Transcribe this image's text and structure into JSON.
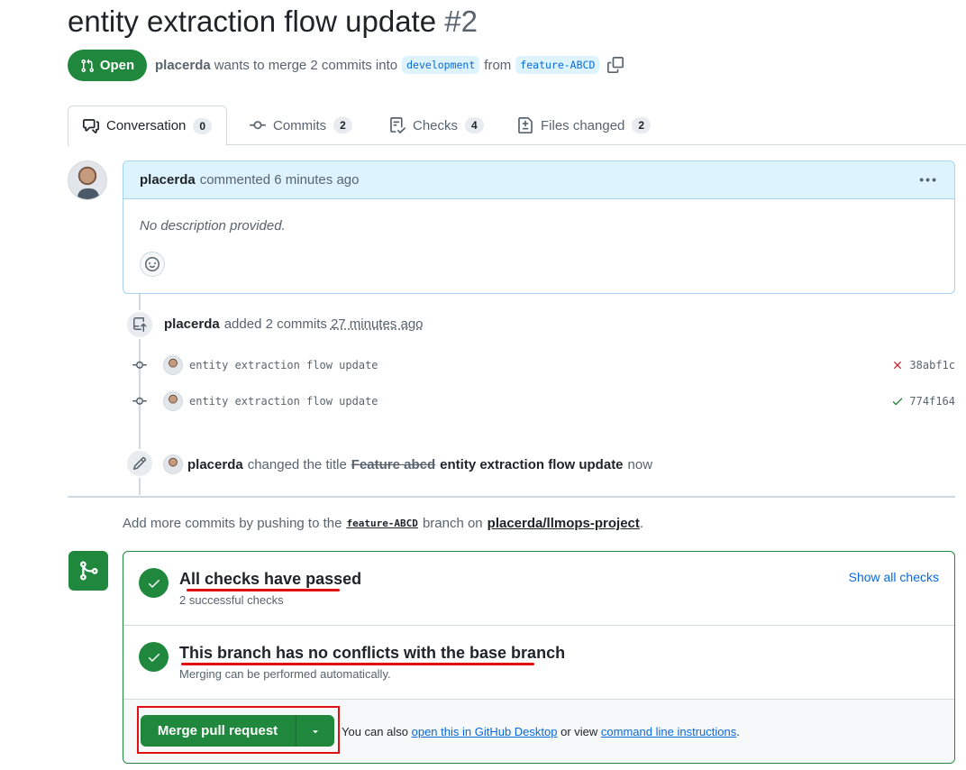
{
  "header": {
    "title": "entity extraction flow update",
    "number": "#2",
    "state": "Open",
    "author": "placerda",
    "merge_text": "wants to merge 2 commits into",
    "base_branch": "development",
    "from_text": "from",
    "head_branch": "feature-ABCD"
  },
  "tabs": [
    {
      "label": "Conversation",
      "count": "0",
      "icon": "conversation-icon"
    },
    {
      "label": "Commits",
      "count": "2",
      "icon": "commit-icon"
    },
    {
      "label": "Checks",
      "count": "4",
      "icon": "checklist-icon"
    },
    {
      "label": "Files changed",
      "count": "2",
      "icon": "file-diff-icon"
    }
  ],
  "comment": {
    "author": "placerda",
    "action": "commented 6 minutes ago",
    "body": "No description provided."
  },
  "timeline": {
    "commits_event": {
      "author": "placerda",
      "action": "added 2 commits",
      "time": "27 minutes ago"
    },
    "commits": [
      {
        "message": "entity extraction flow update",
        "sha": "38abf1c",
        "status": "failed"
      },
      {
        "message": "entity extraction flow update",
        "sha": "774f164",
        "status": "success"
      }
    ],
    "title_event": {
      "author": "placerda",
      "action": "changed the title",
      "old_title": "Feature abcd",
      "new_title": "entity extraction flow update",
      "time": "now"
    }
  },
  "push_note": {
    "prefix": "Add more commits by pushing to the",
    "branch": "feature-ABCD",
    "middle": "branch on",
    "repo": "placerda/llmops-project",
    "suffix": "."
  },
  "merge_box": {
    "checks_title": "All checks have passed",
    "checks_sub": "2 successful checks",
    "show_checks": "Show all checks",
    "conflicts_title": "This branch has no conflicts with the base branch",
    "conflicts_sub": "Merging can be performed automatically.",
    "merge_button": "Merge pull request",
    "footer_prefix": "You can also",
    "footer_link1": "open this in GitHub Desktop",
    "footer_middle": "or view",
    "footer_link2": "command line instructions",
    "footer_suffix": "."
  },
  "colors": {
    "success": "#1f883d",
    "danger": "#cf222e",
    "accent": "#0969da",
    "annotation": "#e01010"
  }
}
